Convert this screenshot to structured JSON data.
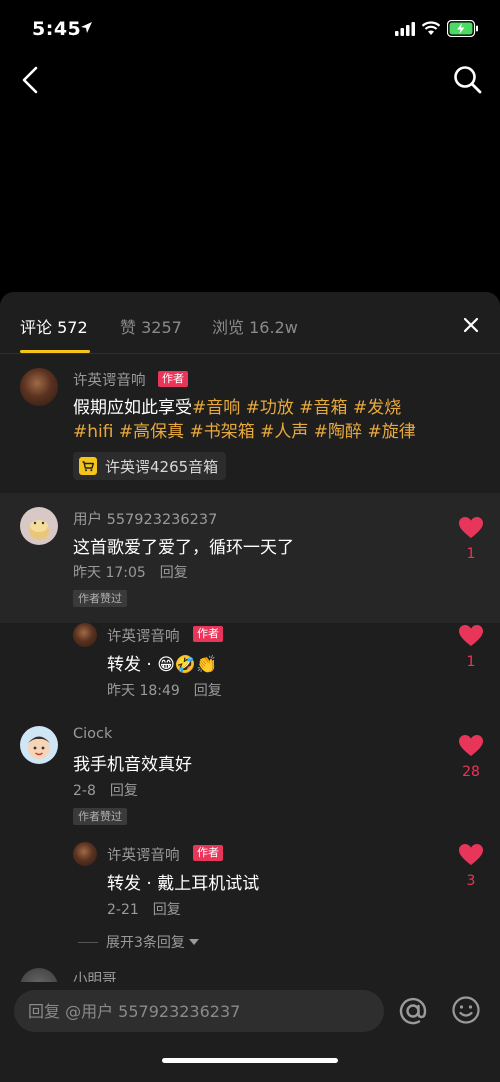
{
  "status_bar": {
    "time": "5:45"
  },
  "tabs": [
    {
      "label": "评论 572"
    },
    {
      "label": "赞 3257"
    },
    {
      "label": "浏览 16.2w"
    }
  ],
  "post": {
    "author": "许英谔音响",
    "author_tag": "作者",
    "text": "假期应如此享受",
    "hashtags_line1": "#音响 #功放 #音箱 #发烧",
    "hashtags_line2": "#hifi #高保真 #书架箱 #人声 #陶醉 #旋律",
    "product": "许英谔4265音箱"
  },
  "comments": [
    {
      "user": "用户 557923236237",
      "text": "这首歌爱了爱了，循环一天了",
      "time": "昨天 17:05",
      "reply": "回复",
      "badge": "作者赞过",
      "likes": "1",
      "sub_reply": {
        "user": "许英谔音响",
        "tag": "作者",
        "text": "转发 · 😁🤣👏",
        "time": "昨天 18:49",
        "reply": "回复",
        "likes": "1"
      }
    },
    {
      "user": "Ciock",
      "text": "我手机音效真好",
      "time": "2-8",
      "reply": "回复",
      "badge": "作者赞过",
      "likes": "28",
      "sub_reply": {
        "user": "许英谔音响",
        "tag": "作者",
        "text": "转发 · 戴上耳机试试",
        "time": "2-21",
        "reply": "回复",
        "likes": "3"
      },
      "expand": "展开3条回复"
    },
    {
      "user": "小明哥"
    }
  ],
  "input": {
    "placeholder": "回复 @用户 557923236237"
  },
  "colors": {
    "accent": "#f5c518",
    "like": "#e8365a",
    "hashtag": "#e8a93c",
    "sheet": "#1e1e1e"
  }
}
